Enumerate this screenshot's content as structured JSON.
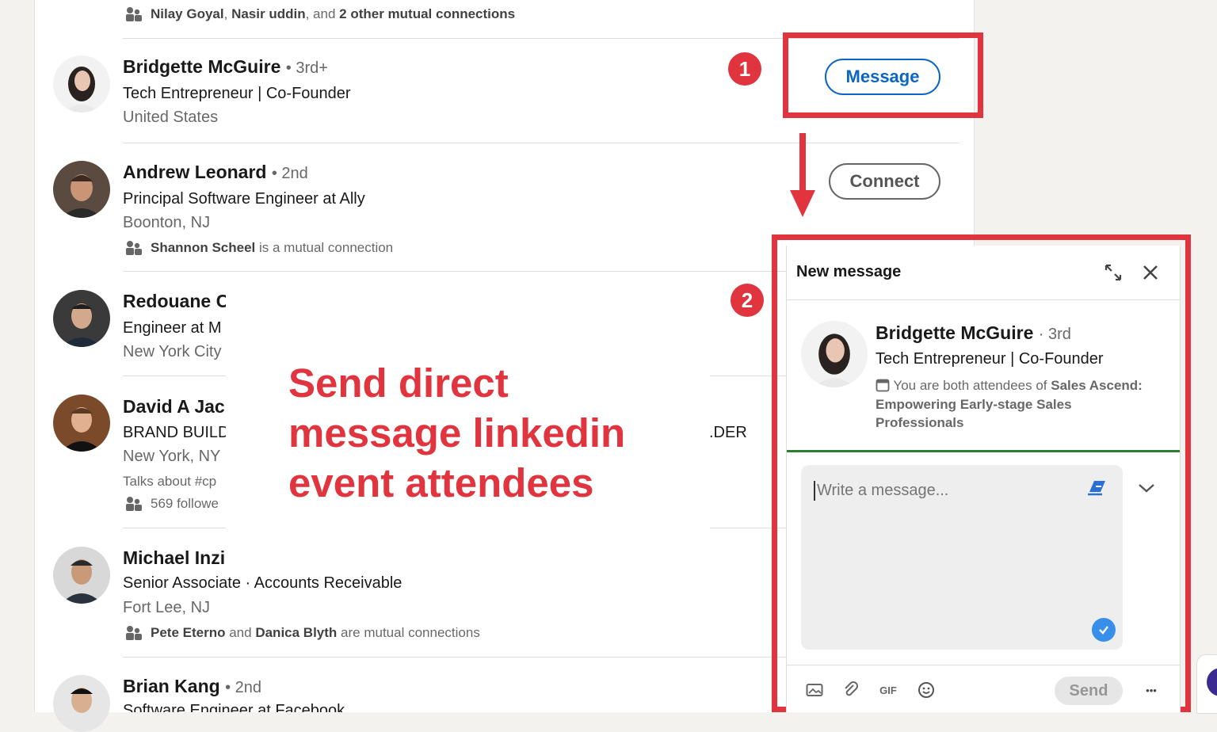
{
  "list": {
    "top_insight": {
      "names_a": "Nilay Goyal",
      "sep_a": ",",
      "names_b": "Nasir uddin",
      "mid": ", and",
      "names_c": "2 other mutual connections"
    },
    "people": [
      {
        "name": "Bridgette McGuire",
        "degree": "• 3rd+",
        "headline": "Tech Entrepreneur | Co-Founder",
        "location": "United States",
        "action": "Message"
      },
      {
        "name": "Andrew Leonard",
        "degree": "• 2nd",
        "headline": "Principal Software Engineer at Ally",
        "location": "Boonton, NJ",
        "insight_bold": "Shannon Scheel",
        "insight_rest": "is a mutual connection",
        "action": "Connect"
      },
      {
        "name": "Redouane C",
        "headline": "Engineer at M",
        "location": "New York City"
      },
      {
        "name": "David A Jac",
        "headline": "BRAND BUILD",
        "headline_tail": ".DER",
        "location": "New York, NY",
        "talks": "Talks about #cp",
        "followers": "569 followe"
      },
      {
        "name": "Michael Inzi",
        "headline": "Senior Associate · Accounts Receivable",
        "location": "Fort Lee, NJ",
        "insight_bold_a": "Pete Eterno",
        "insight_mid": "and",
        "insight_bold_b": "Danica Blyth",
        "insight_rest": "are mutual connections"
      },
      {
        "name": "Brian Kang",
        "degree": "• 2nd",
        "headline": "Software Engineer at Facebook"
      }
    ]
  },
  "annotations": {
    "step1": "1",
    "step2": "2",
    "caption": [
      "Send direct",
      "message linkedin",
      "event attendees"
    ],
    "accent_color": "#e0353f"
  },
  "panel": {
    "title": "New message",
    "recipient_name": "Bridgette McGuire",
    "recipient_degree": "· 3rd",
    "recipient_headline": "Tech Entrepreneur | Co-Founder",
    "event_prefix": "You are both attendees of",
    "event_name": "Sales Ascend: Empowering Early-stage Sales Professionals",
    "placeholder": "Write a message...",
    "send_label": "Send",
    "gif_label": "GIF",
    "more_label": "•••",
    "icons": [
      "expand-icon",
      "close-icon",
      "extension-icon",
      "chevron-down-icon",
      "check-icon",
      "image-icon",
      "attach-icon",
      "gif-icon",
      "emoji-icon",
      "more-icon"
    ]
  }
}
